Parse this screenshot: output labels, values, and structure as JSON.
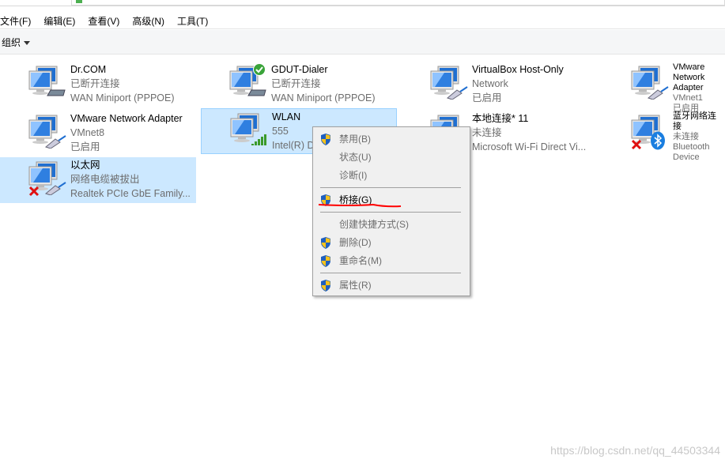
{
  "menubar": [
    "文件(F)",
    "编辑(E)",
    "查看(V)",
    "高级(N)",
    "工具(T)"
  ],
  "toolbar": {
    "organize": "组织"
  },
  "tiles": [
    {
      "name": "Dr.COM",
      "line2": "已断开连接",
      "line3": "WAN Miniport (PPPOE)",
      "icon": "modem",
      "badge": ""
    },
    {
      "name": "GDUT-Dialer",
      "line2": "已断开连接",
      "line3": "WAN Miniport (PPPOE)",
      "icon": "modem",
      "badge": "check"
    },
    {
      "name": "VirtualBox Host-Only",
      "line2": "Network",
      "line3": "已启用",
      "icon": "ethernet",
      "badge": ""
    },
    {
      "name": "VMware Network Adapter",
      "line2": "VMnet1",
      "line3": "已启用",
      "icon": "ethernet",
      "badge": ""
    },
    {
      "name": "VMware Network Adapter",
      "line2": "VMnet8",
      "line3": "已启用",
      "icon": "ethernet",
      "badge": ""
    },
    {
      "name": "WLAN",
      "line2": "555",
      "line3": "Intel(R) Dual Band Wireless",
      "icon": "wifi",
      "badge": "",
      "state": "selected-focus"
    },
    {
      "name": "本地连接* 11",
      "line2": "未连接",
      "line3": "Microsoft Wi-Fi Direct Vi...",
      "icon": "ethernet",
      "badge": ""
    },
    {
      "name": "蓝牙网络连接",
      "line2": "未连接",
      "line3": "Bluetooth Device",
      "icon": "bluetooth",
      "badge": "x"
    },
    {
      "name": "以太网",
      "line2": "网络电缆被拔出",
      "line3": "Realtek PCIe GbE Family...",
      "icon": "ethernet",
      "badge": "x",
      "state": "selected"
    }
  ],
  "context_menu": [
    {
      "label": "禁用(B)",
      "shield": true,
      "enabled": false
    },
    {
      "label": "状态(U)",
      "shield": false,
      "enabled": false
    },
    {
      "label": "诊断(I)",
      "shield": false,
      "enabled": false
    },
    {
      "sep": true
    },
    {
      "label": "桥接(G)",
      "shield": true,
      "enabled": true,
      "annotated": true
    },
    {
      "sep": true
    },
    {
      "label": "创建快捷方式(S)",
      "shield": false,
      "enabled": false
    },
    {
      "label": "删除(D)",
      "shield": true,
      "enabled": false
    },
    {
      "label": "重命名(M)",
      "shield": true,
      "enabled": false
    },
    {
      "sep": true
    },
    {
      "label": "属性(R)",
      "shield": true,
      "enabled": false
    }
  ],
  "colors": {
    "selection": "#cce8ff",
    "annotation": "#ff0000",
    "accent": "#0078d7"
  },
  "watermark": "https://blog.csdn.net/qq_44503344"
}
